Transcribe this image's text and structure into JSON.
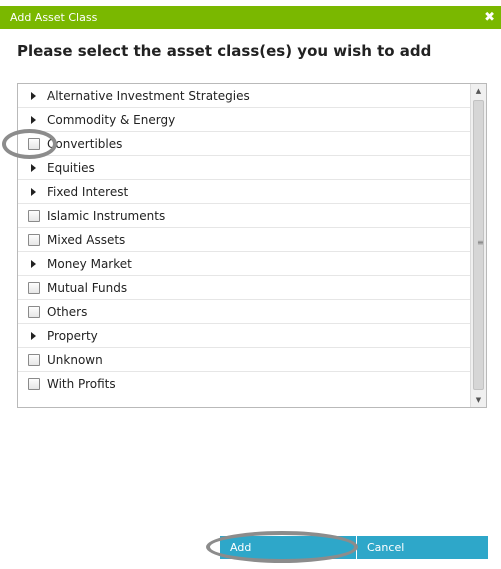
{
  "dialog": {
    "title": "Add Asset Class",
    "close_icon": "close-icon",
    "heading": "Please select the asset class(es) you wish to add"
  },
  "asset_classes": [
    {
      "label": "Alternative Investment Strategies",
      "type": "expandable"
    },
    {
      "label": "Commodity & Energy",
      "type": "expandable"
    },
    {
      "label": "Convertibles",
      "type": "checkbox",
      "checked": false
    },
    {
      "label": "Equities",
      "type": "expandable"
    },
    {
      "label": "Fixed Interest",
      "type": "expandable"
    },
    {
      "label": "Islamic Instruments",
      "type": "checkbox",
      "checked": false
    },
    {
      "label": "Mixed Assets",
      "type": "checkbox",
      "checked": false
    },
    {
      "label": "Money Market",
      "type": "expandable"
    },
    {
      "label": "Mutual Funds",
      "type": "checkbox",
      "checked": false
    },
    {
      "label": "Others",
      "type": "checkbox",
      "checked": false
    },
    {
      "label": "Property",
      "type": "expandable"
    },
    {
      "label": "Unknown",
      "type": "checkbox",
      "checked": false
    },
    {
      "label": "With Profits",
      "type": "checkbox",
      "checked": false
    }
  ],
  "buttons": {
    "add_label": "Add",
    "cancel_label": "Cancel"
  },
  "colors": {
    "titlebar": "#7ab800",
    "button": "#2ea7c9",
    "highlight_ring": "#8c8c8c"
  }
}
